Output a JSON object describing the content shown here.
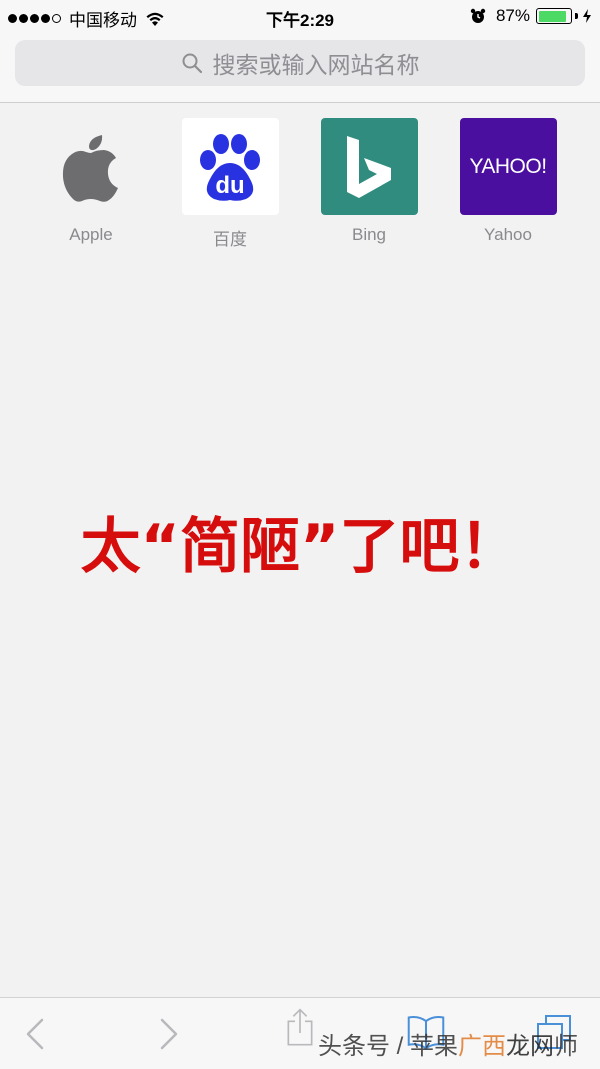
{
  "status_bar": {
    "carrier": "中国移动",
    "time": "下午2:29",
    "battery_percent": "87%",
    "signal_bars_filled": 4,
    "signal_bars_total": 5,
    "battery_level": 0.87,
    "battery_color": "#4cd964"
  },
  "search": {
    "placeholder": "搜索或输入网站名称",
    "icon": "search-icon"
  },
  "favorites": [
    {
      "label": "Apple",
      "icon": "apple-logo-icon"
    },
    {
      "label": "百度",
      "icon": "baidu-paw-icon",
      "logo_text": "du"
    },
    {
      "label": "Bing",
      "icon": "bing-logo-icon"
    },
    {
      "label": "Yahoo",
      "icon": "yahoo-logo-icon",
      "logo_text": "YAHOO!"
    }
  ],
  "overlay_caption": "太“简陋”了吧！",
  "toolbar": {
    "back_icon": "chevron-left-icon",
    "forward_icon": "chevron-right-icon",
    "share_icon": "share-icon",
    "bookmarks_icon": "book-icon",
    "tabs_icon": "tabs-icon"
  },
  "watermark": {
    "part1": "头条号 / 苹果",
    "part2": "广西",
    "part3": "龙网",
    "part4": "师"
  },
  "colors": {
    "caption_red": "#d60d0d",
    "bing_teal": "#2f8c7f",
    "yahoo_purple": "#4b0fa0",
    "baidu_blue": "#2932e1"
  }
}
